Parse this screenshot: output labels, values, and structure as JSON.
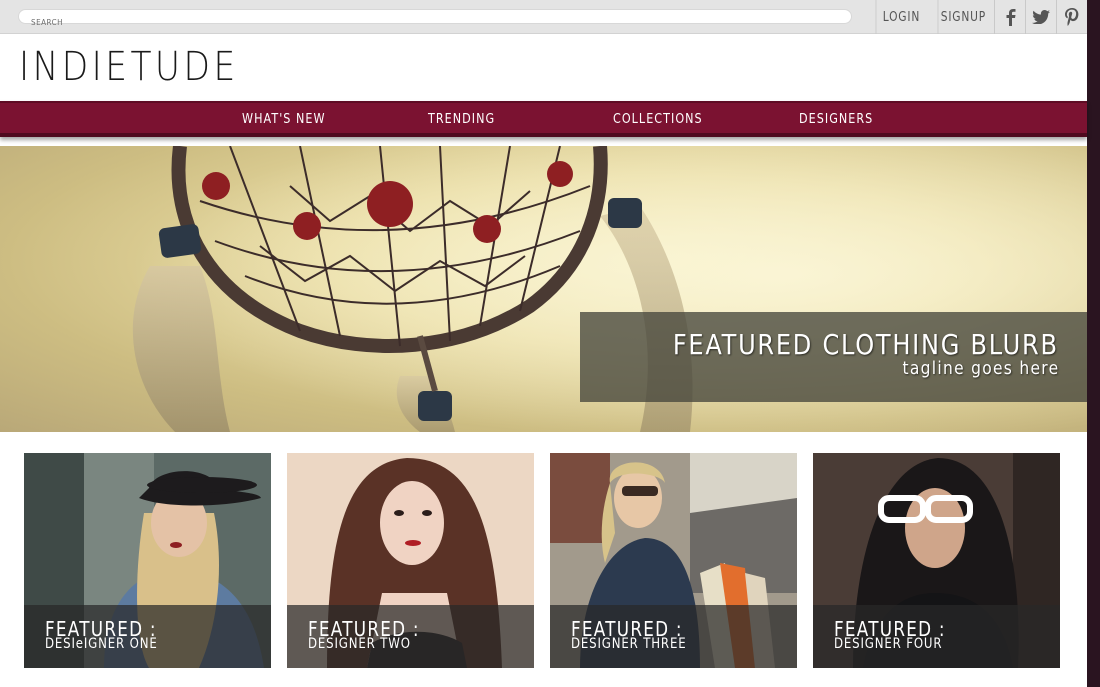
{
  "search": {
    "placeholder": "SEARCH"
  },
  "account": {
    "login": "LOGIN",
    "signup": "SIGNUP"
  },
  "social": [
    "facebook-icon",
    "twitter-icon",
    "pinterest-icon"
  ],
  "brand": {
    "logo": "INDIETUDE",
    "nav_color": "#7b1231"
  },
  "nav": [
    "WHAT'S NEW",
    "TRENDING",
    "COLLECTIONS",
    "DESIGNERS"
  ],
  "hero": {
    "title": "FEATURED CLOTHING BLURB",
    "tagline": "tagline goes here"
  },
  "cards": [
    {
      "line1": "FEATURED :",
      "line2": "DESIeIGNER ONE"
    },
    {
      "line1": "FEATURED :",
      "line2": "DESIGNER TWO"
    },
    {
      "line1": "FEATURED :",
      "line2": "DESIGNER THREE"
    },
    {
      "line1": "FEATURED :",
      "line2": "DESIGNER FOUR"
    }
  ]
}
